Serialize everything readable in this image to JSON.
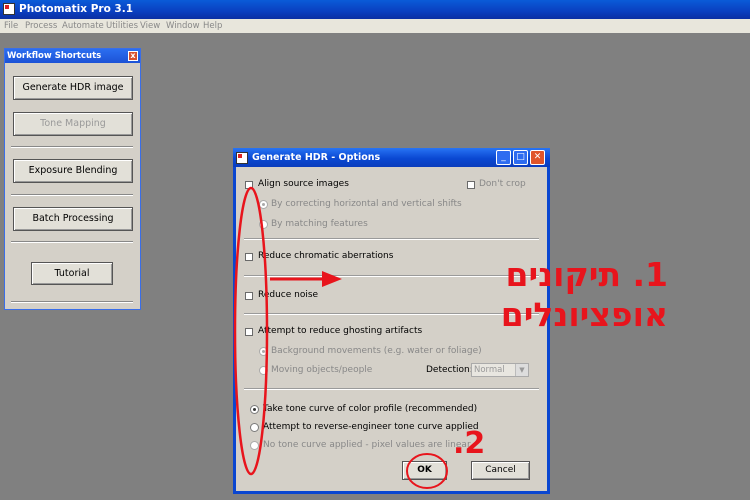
{
  "app": {
    "title": "Photomatix Pro 3.1"
  },
  "menu": [
    "File",
    "Process",
    "Automate",
    "Utilities",
    "View",
    "Window",
    "Help"
  ],
  "workflow": {
    "title": "Workflow Shortcuts",
    "close": "x",
    "buttons": {
      "generate": "Generate HDR image",
      "tone": "Tone Mapping",
      "blending": "Exposure Blending",
      "batch": "Batch Processing",
      "tutorial": "Tutorial"
    }
  },
  "dialog": {
    "title": "Generate HDR - Options",
    "align": "Align source images",
    "dont_crop": "Don't crop",
    "align_opt1": "By correcting horizontal and vertical shifts",
    "align_opt2": "By matching features",
    "chromatic": "Reduce chromatic aberrations",
    "noise": "Reduce noise",
    "ghosting": "Attempt to reduce ghosting artifacts",
    "ghost_opt1": "Background movements (e.g. water or foliage)",
    "ghost_opt2": "Moving objects/people",
    "detection_label": "Detection:",
    "detection_value": "Normal",
    "tone1": "Take tone curve of color profile (recommended)",
    "tone2": "Attempt to reverse-engineer tone curve applied",
    "tone3": "No tone curve applied - pixel values are linear",
    "ok": "OK",
    "cancel": "Cancel"
  },
  "annotations": {
    "label1": "1. תיקונים אופציונלים",
    "label2": "2."
  },
  "colors": {
    "annotation": "#e8141c",
    "titlebar": "#0a46d0",
    "desktop": "#808080"
  }
}
